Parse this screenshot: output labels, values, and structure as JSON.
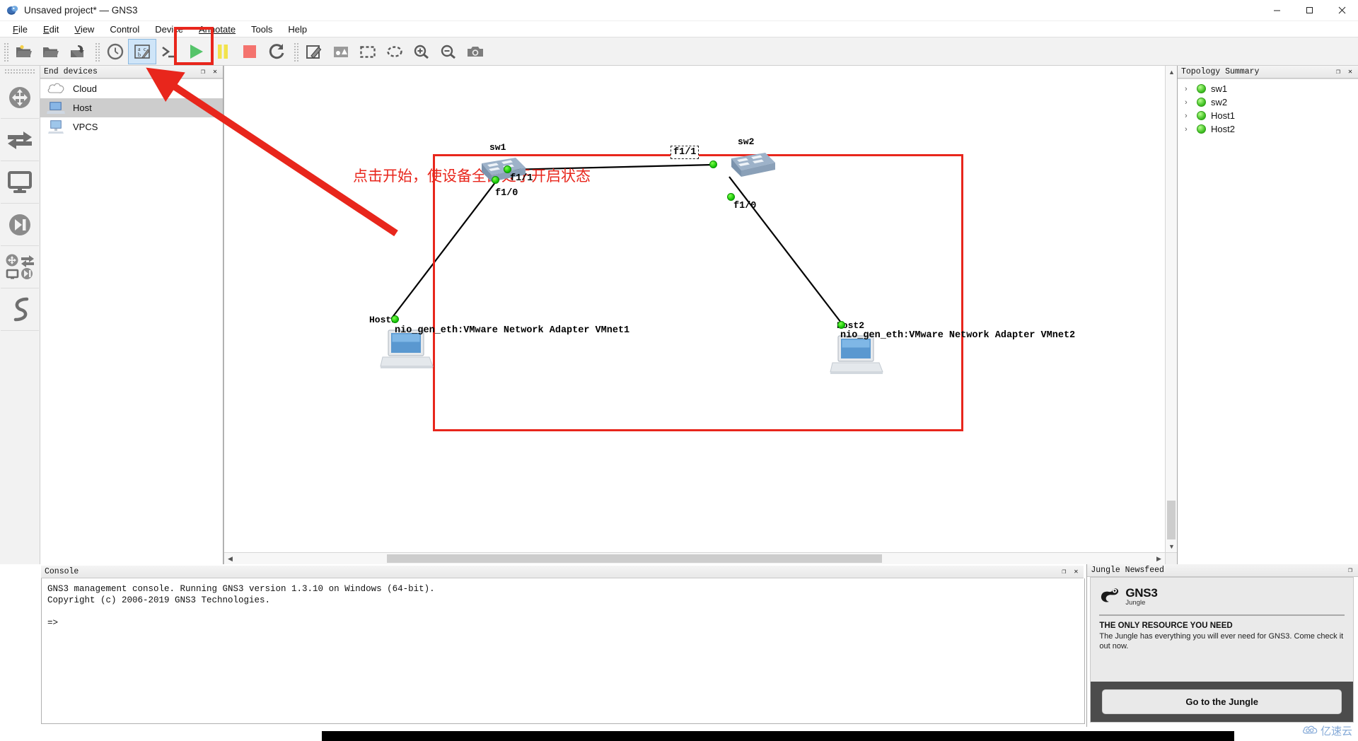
{
  "window": {
    "title": "Unsaved project* — GNS3",
    "app_icon": "gns3-logo-icon",
    "minimize": "–",
    "maximize": "▢",
    "close": "✕"
  },
  "menubar": {
    "items": [
      {
        "label": "File",
        "mnemonic": "F"
      },
      {
        "label": "Edit",
        "mnemonic": "E"
      },
      {
        "label": "View",
        "mnemonic": "V"
      },
      {
        "label": "Control",
        "mnemonic": "C"
      },
      {
        "label": "Device",
        "mnemonic": "D"
      },
      {
        "label": "Annotate",
        "mnemonic": "A"
      },
      {
        "label": "Tools",
        "mnemonic": "T"
      },
      {
        "label": "Help",
        "mnemonic": "H"
      }
    ]
  },
  "toolbar": {
    "groups": [
      {
        "buttons": [
          {
            "name": "new-project-icon",
            "tooltip": "New project"
          },
          {
            "name": "open-project-icon",
            "tooltip": "Open project"
          },
          {
            "name": "save-project-as-icon",
            "tooltip": "Save project as"
          }
        ]
      },
      {
        "buttons": [
          {
            "name": "snapshot-clock-icon",
            "tooltip": "Snapshots"
          },
          {
            "name": "show-hide-interface-labels-icon",
            "tooltip": "Show/Hide interface labels",
            "selected": true
          },
          {
            "name": "console-to-all-devices-icon",
            "tooltip": "Console connect to all devices"
          },
          {
            "name": "start-all-devices-icon",
            "tooltip": "Start/Resume all devices",
            "highlighted": true
          },
          {
            "name": "suspend-all-devices-icon",
            "tooltip": "Suspend all devices"
          },
          {
            "name": "stop-all-devices-icon",
            "tooltip": "Stop all devices"
          },
          {
            "name": "reload-all-devices-icon",
            "tooltip": "Reload all devices"
          }
        ]
      },
      {
        "buttons": [
          {
            "name": "add-note-icon",
            "tooltip": "Add a note"
          },
          {
            "name": "insert-picture-icon",
            "tooltip": "Insert a picture"
          },
          {
            "name": "draw-rectangle-icon",
            "tooltip": "Draw a rectangle"
          },
          {
            "name": "draw-ellipse-icon",
            "tooltip": "Draw an ellipse"
          },
          {
            "name": "zoom-in-icon",
            "tooltip": "Zoom in"
          },
          {
            "name": "zoom-out-icon",
            "tooltip": "Zoom out"
          },
          {
            "name": "screenshot-icon",
            "tooltip": "Take a screenshot"
          }
        ]
      }
    ]
  },
  "rail": {
    "buttons": [
      {
        "name": "routers-icon",
        "tooltip": "Routers"
      },
      {
        "name": "switches-icon",
        "tooltip": "Switches"
      },
      {
        "name": "end-devices-icon",
        "tooltip": "End devices"
      },
      {
        "name": "security-devices-icon",
        "tooltip": "Security devices"
      },
      {
        "name": "all-devices-icon",
        "tooltip": "All devices"
      },
      {
        "name": "add-link-icon",
        "tooltip": "Add a link"
      }
    ]
  },
  "end_devices_dock": {
    "title": "End devices",
    "float_btn": "❐",
    "close_btn": "✕",
    "items": [
      {
        "label": "Cloud",
        "icon": "cloud-icon",
        "selected": false
      },
      {
        "label": "Host",
        "icon": "host-laptop-icon",
        "selected": true
      },
      {
        "label": "VPCS",
        "icon": "vpcs-desktop-icon",
        "selected": false
      }
    ]
  },
  "canvas": {
    "annotation_text": "点击开始，使设备全部处于开启状态",
    "annotation_color": "#e8261c",
    "selection_rect_color": "#e8261c",
    "nodes": [
      {
        "id": "sw1",
        "label": "sw1",
        "type": "switch"
      },
      {
        "id": "sw2",
        "label": "sw2",
        "type": "switch"
      },
      {
        "id": "Host1",
        "label": "Host1",
        "type": "host",
        "interface": "nio_gen_eth:VMware Network Adapter VMnet1"
      },
      {
        "id": "Host2",
        "label": "Host2",
        "type": "host",
        "interface": "nio_gen_eth:VMware Network Adapter VMnet2"
      }
    ],
    "port_labels": [
      {
        "text": "f1/1",
        "node": "sw1",
        "boxed": false
      },
      {
        "text": "f1/0",
        "node": "sw1",
        "boxed": false
      },
      {
        "text": "f1/1",
        "node": "sw2",
        "boxed": true
      },
      {
        "text": "f1/0",
        "node": "sw2",
        "boxed": false
      }
    ],
    "links": [
      {
        "from": "sw1",
        "to": "sw2"
      },
      {
        "from": "sw1",
        "to": "Host1"
      },
      {
        "from": "sw2",
        "to": "Host2"
      }
    ]
  },
  "topology_summary": {
    "title": "Topology Summary",
    "float_btn": "❐",
    "close_btn": "✕",
    "rows": [
      {
        "chevron": "›",
        "label": "sw1",
        "status": "running"
      },
      {
        "chevron": "›",
        "label": "sw2",
        "status": "running"
      },
      {
        "chevron": "›",
        "label": "Host1",
        "status": "running"
      },
      {
        "chevron": "›",
        "label": "Host2",
        "status": "running"
      }
    ]
  },
  "console": {
    "title": "Console",
    "float_btn": "❐",
    "close_btn": "✕",
    "text": "GNS3 management console. Running GNS3 version 1.3.10 on Windows (64-bit).\nCopyright (c) 2006-2019 GNS3 Technologies.\n\n=>"
  },
  "jungle": {
    "title": "Jungle Newsfeed",
    "float_btn": "❐",
    "logo_name": "GNS3",
    "logo_sub": "Jungle",
    "headline": "THE ONLY RESOURCE YOU NEED",
    "body": "The Jungle has everything you will ever need for GNS3. Come check it out now.",
    "button_label": "Go to the Jungle"
  },
  "watermark": {
    "text": "亿速云",
    "icon": "cloud-watermark-icon"
  }
}
